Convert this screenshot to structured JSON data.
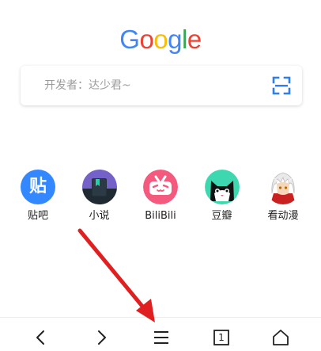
{
  "google_logo": {
    "letters": [
      "G",
      "o",
      "o",
      "g",
      "l",
      "e"
    ],
    "colors": [
      "#4285F4",
      "#EA4335",
      "#FBBC05",
      "#4285F4",
      "#34A853",
      "#EA4335"
    ]
  },
  "search": {
    "placeholder": "开发者：达少君~",
    "scan_icon": "scan-qr-icon",
    "accent": "#2f80ed"
  },
  "shortcuts": [
    {
      "label": "贴吧",
      "icon": "tieba-icon",
      "icon_text": "贴",
      "color": "#3388ff"
    },
    {
      "label": "小说",
      "icon": "novel-icon",
      "color": "#6f5fc7"
    },
    {
      "label": "BiliBili",
      "icon": "bilibili-icon",
      "color": "#f45a7d"
    },
    {
      "label": "豆瓣",
      "icon": "douban-cat-icon",
      "color": "#3ed8b0"
    },
    {
      "label": "看动漫",
      "icon": "anime-character-icon",
      "color": "#c92020"
    }
  ],
  "bottom_bar": {
    "items": [
      "back-icon",
      "forward-icon",
      "menu-icon",
      "tabs-icon",
      "home-icon"
    ],
    "tab_count": "1"
  },
  "annotation": {
    "arrow_color": "#e02020"
  }
}
